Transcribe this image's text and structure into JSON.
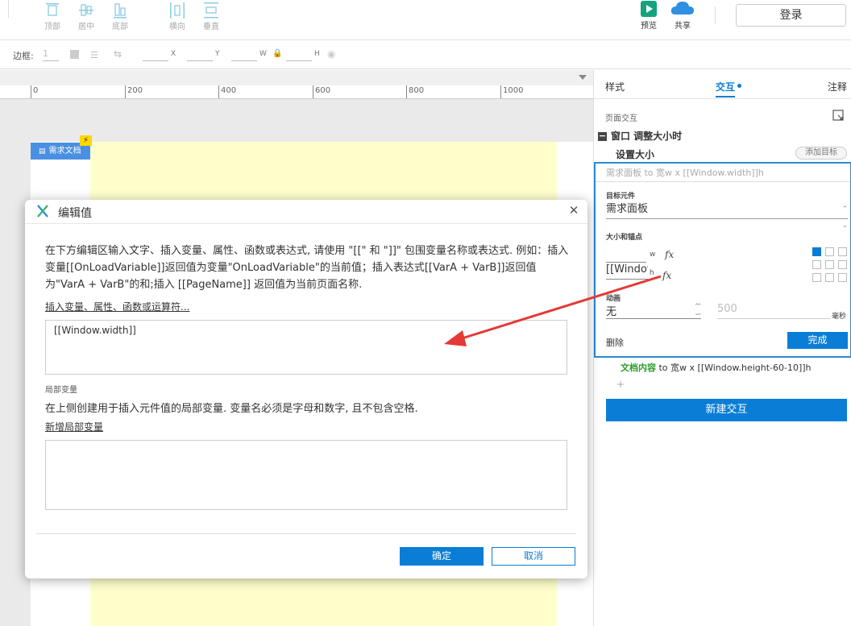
{
  "toolbar": {
    "align_items": [
      "顶部",
      "居中",
      "底部"
    ],
    "distribute_items": [
      "横向",
      "垂直"
    ],
    "preview_label": "预览",
    "share_label": "共享",
    "login_label": "登录"
  },
  "toolbar2": {
    "border_label": "边框:",
    "border_value": "1",
    "x_label": "X",
    "y_label": "Y",
    "w_label": "W",
    "h_label": "H"
  },
  "ruler": {
    "ticks": [
      "0",
      "200",
      "400",
      "600",
      "800",
      "1000"
    ]
  },
  "canvas": {
    "req_tag": "需求文档",
    "bolt": "⚡"
  },
  "panel": {
    "tabs": [
      "样式",
      "交互",
      "注释"
    ],
    "page_interactions": "页面交互",
    "event_title": "窗口 调整大小时",
    "action_title": "设置大小",
    "add_target": "添加目标",
    "editing_summary": "需求面板 to 宽w x [[Window.width]]h",
    "target_label": "目标元件",
    "target_value": "需求面板",
    "size_label": "大小和锚点",
    "width_value": "",
    "w_unit": "w",
    "height_value": "[[Window.",
    "h_unit": "h",
    "fx": "fx",
    "anim_label": "动画",
    "anim_value": "无",
    "duration_value": "500",
    "duration_unit": "毫秒",
    "delete_label": "删除",
    "done_label": "完成",
    "second_action_name": "文档内容",
    "second_action_rest": " to 宽w x [[Window.height-60-10]]h",
    "plus": "+",
    "new_interaction": "新建交互"
  },
  "dialog": {
    "title": "编辑值",
    "close": "✕",
    "description": "在下方编辑区输入文字、插入变量、属性、函数或表达式, 请使用 \"[[\" 和 \"]]\" 包围变量名称或表达式. 例如：插入变量[[OnLoadVariable]]返回值为变量\"OnLoadVariable\"的当前值；插入表达式[[VarA + VarB]]返回值为\"VarA + VarB\"的和;插入 [[PageName]] 返回值为当前页面名称.",
    "insert_link": "插入变量、属性、函数或运算符...",
    "editor_value": "[[Window.width]]",
    "local_vars_title": "局部变量",
    "local_vars_desc": "在上侧创建用于插入元件值的局部变量. 变量名必须是字母和数字, 且不包含空格.",
    "add_local_var": "新增局部变量",
    "ok_label": "确定",
    "cancel_label": "取消"
  },
  "colors": {
    "accent": "#0a7ed6",
    "highlight_box": "#2d8ad4",
    "arrow": "#e53935",
    "page_yellow": "#ffffcc"
  }
}
